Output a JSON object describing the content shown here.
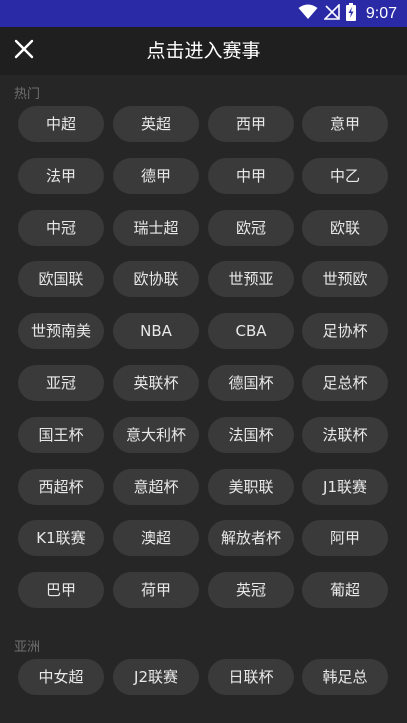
{
  "status_bar": {
    "time": "9:07",
    "icons": [
      "wifi-icon",
      "signal-off-icon",
      "battery-charging-icon"
    ]
  },
  "app_bar": {
    "title": "点击进入赛事",
    "close_icon": "close-icon"
  },
  "sections": [
    {
      "label": "热门",
      "items": [
        "中超",
        "英超",
        "西甲",
        "意甲",
        "法甲",
        "德甲",
        "中甲",
        "中乙",
        "中冠",
        "瑞士超",
        "欧冠",
        "欧联",
        "欧国联",
        "欧协联",
        "世预亚",
        "世预欧",
        "世预南美",
        "NBA",
        "CBA",
        "足协杯",
        "亚冠",
        "英联杯",
        "德国杯",
        "足总杯",
        "国王杯",
        "意大利杯",
        "法国杯",
        "法联杯",
        "西超杯",
        "意超杯",
        "美职联",
        "J1联赛",
        "K1联赛",
        "澳超",
        "解放者杯",
        "阿甲",
        "巴甲",
        "荷甲",
        "英冠",
        "葡超"
      ]
    },
    {
      "label": "亚洲",
      "items": [
        "中女超",
        "J2联赛",
        "日联杯",
        "韩足总"
      ]
    }
  ]
}
